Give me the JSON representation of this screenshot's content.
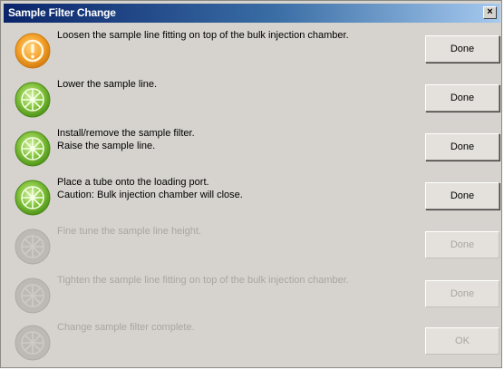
{
  "window": {
    "title": "Sample Filter Change",
    "close_label": "×"
  },
  "colors": {
    "titlebar_start": "#0a246a",
    "titlebar_end": "#a6caf0",
    "current_icon": "#f0a020",
    "completed_icon": "#6cb42a",
    "pending_icon": "#b8b5b0",
    "dialog_bg": "#d6d3ce",
    "disabled_text": "#a9a6a0"
  },
  "steps": [
    {
      "icon": "exclamation-icon",
      "state": "current",
      "lines": [
        "Loosen the sample line fitting on top of the bulk injection chamber."
      ],
      "button_label": "Done"
    },
    {
      "icon": "check-icon",
      "state": "completed",
      "lines": [
        "Lower the sample line."
      ],
      "button_label": "Done"
    },
    {
      "icon": "check-icon",
      "state": "completed",
      "lines": [
        "Install/remove the sample filter.",
        "Raise the sample line."
      ],
      "button_label": "Done"
    },
    {
      "icon": "check-icon",
      "state": "completed",
      "lines": [
        "Place a tube onto the loading port.",
        "Caution: Bulk injection chamber will close."
      ],
      "button_label": "Done"
    },
    {
      "icon": "pending-icon",
      "state": "pending",
      "lines": [
        "Fine tune the sample line height."
      ],
      "button_label": "Done"
    },
    {
      "icon": "pending-icon",
      "state": "pending",
      "lines": [
        "Tighten the sample line fitting on top of the bulk injection chamber."
      ],
      "button_label": "Done"
    },
    {
      "icon": "pending-icon",
      "state": "pending",
      "lines": [
        "Change sample filter complete."
      ],
      "button_label": "OK"
    }
  ]
}
